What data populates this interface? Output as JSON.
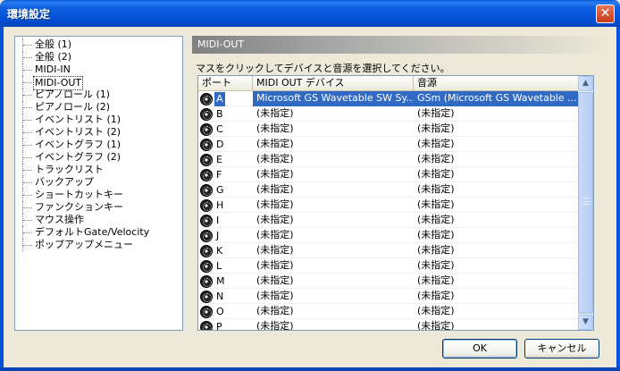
{
  "window": {
    "title": "環境設定",
    "close_glyph": "✕"
  },
  "tree": {
    "items": [
      {
        "label": "全般 (1)"
      },
      {
        "label": "全般 (2)"
      },
      {
        "label": "MIDI-IN"
      },
      {
        "label": "MIDI-OUT",
        "selected": true
      },
      {
        "label": "ピアノロール (1)"
      },
      {
        "label": "ピアノロール (2)"
      },
      {
        "label": "イベントリスト (1)"
      },
      {
        "label": "イベントリスト (2)"
      },
      {
        "label": "イベントグラフ (1)"
      },
      {
        "label": "イベントグラフ (2)"
      },
      {
        "label": "トラックリスト"
      },
      {
        "label": "バックアップ"
      },
      {
        "label": "ショートカットキー"
      },
      {
        "label": "ファンクションキー"
      },
      {
        "label": "マウス操作"
      },
      {
        "label": "デフォルトGate/Velocity"
      },
      {
        "label": "ポップアップメニュー"
      }
    ]
  },
  "panel": {
    "header": "MIDI-OUT",
    "instruction": "マスをクリックしてデバイスと音源を選択してください。"
  },
  "grid": {
    "columns": [
      "ポート",
      "MIDI OUT デバイス",
      "音源"
    ],
    "rows": [
      {
        "port": "A",
        "device": "Microsoft GS Wavetable SW Sy...",
        "source": "GSm (Microsoft GS Wavetable ...",
        "selected": true
      },
      {
        "port": "B",
        "device": "(未指定)",
        "source": "(未指定)"
      },
      {
        "port": "C",
        "device": "(未指定)",
        "source": "(未指定)"
      },
      {
        "port": "D",
        "device": "(未指定)",
        "source": "(未指定)"
      },
      {
        "port": "E",
        "device": "(未指定)",
        "source": "(未指定)"
      },
      {
        "port": "F",
        "device": "(未指定)",
        "source": "(未指定)"
      },
      {
        "port": "G",
        "device": "(未指定)",
        "source": "(未指定)"
      },
      {
        "port": "H",
        "device": "(未指定)",
        "source": "(未指定)"
      },
      {
        "port": "I",
        "device": "(未指定)",
        "source": "(未指定)"
      },
      {
        "port": "J",
        "device": "(未指定)",
        "source": "(未指定)"
      },
      {
        "port": "K",
        "device": "(未指定)",
        "source": "(未指定)"
      },
      {
        "port": "L",
        "device": "(未指定)",
        "source": "(未指定)"
      },
      {
        "port": "M",
        "device": "(未指定)",
        "source": "(未指定)"
      },
      {
        "port": "N",
        "device": "(未指定)",
        "source": "(未指定)"
      },
      {
        "port": "O",
        "device": "(未指定)",
        "source": "(未指定)"
      },
      {
        "port": "P",
        "device": "(未指定)",
        "source": "(未指定)"
      }
    ],
    "scroll_up_glyph": "▲",
    "scroll_down_glyph": "▼"
  },
  "buttons": {
    "ok": "OK",
    "cancel": "キャンセル"
  },
  "colors": {
    "title_bar": "#0551d8",
    "selection": "#316ac5",
    "dialog_bg": "#ece9d8"
  }
}
